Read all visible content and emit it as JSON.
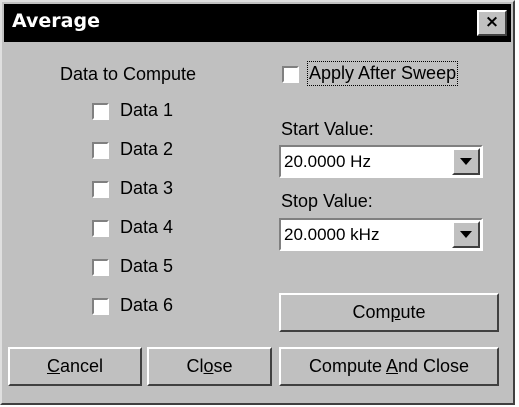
{
  "window": {
    "title": "Average",
    "close_glyph": "×"
  },
  "data_group": {
    "heading": "Data to Compute",
    "items": [
      {
        "label": "Data 1",
        "checked": false
      },
      {
        "label": "Data 2",
        "checked": false
      },
      {
        "label": "Data 3",
        "checked": false
      },
      {
        "label": "Data 4",
        "checked": false
      },
      {
        "label": "Data 5",
        "checked": false
      },
      {
        "label": "Data 6",
        "checked": false
      }
    ]
  },
  "apply_after_sweep": {
    "label": "Apply After Sweep",
    "checked": false
  },
  "start": {
    "label": "Start Value:",
    "value": "20.0000  Hz"
  },
  "stop": {
    "label": "Stop Value:",
    "value": "20.0000 kHz"
  },
  "buttons": {
    "compute": {
      "pre": "Com",
      "mn": "p",
      "post": "ute"
    },
    "cancel": {
      "pre": "",
      "mn": "C",
      "post": "ancel"
    },
    "close": {
      "pre": "Cl",
      "mn": "o",
      "post": "se"
    },
    "compute_and_close": {
      "pre": "Compute ",
      "mn": "A",
      "post": "nd Close"
    }
  },
  "icons": {
    "close": "close-icon",
    "dropdown": "chevron-down-icon"
  },
  "colors": {
    "face": "#c0c0c0",
    "titlebar": "#000000",
    "title_text": "#ffffff"
  }
}
